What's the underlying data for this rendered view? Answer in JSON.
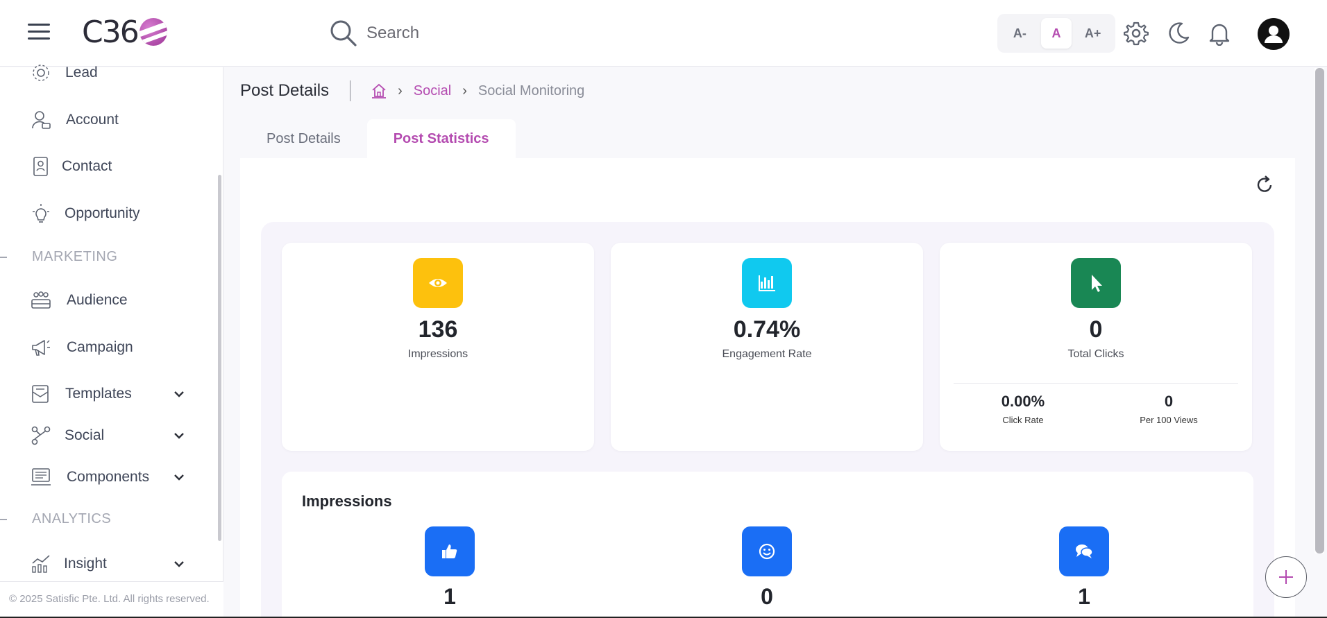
{
  "header": {
    "logo_text": "C36",
    "search_placeholder": "Search",
    "font_small": "A-",
    "font_normal": "A",
    "font_large": "A+"
  },
  "sidebar": {
    "items": [
      {
        "label": "Lead",
        "icon": "lead-icon"
      },
      {
        "label": "Account",
        "icon": "account-icon"
      },
      {
        "label": "Contact",
        "icon": "contact-icon"
      },
      {
        "label": "Opportunity",
        "icon": "lightbulb-icon"
      },
      {
        "label": "Audience",
        "icon": "audience-icon"
      },
      {
        "label": "Campaign",
        "icon": "megaphone-icon"
      },
      {
        "label": "Templates",
        "icon": "templates-icon"
      },
      {
        "label": "Social",
        "icon": "social-icon"
      },
      {
        "label": "Components",
        "icon": "components-icon"
      },
      {
        "label": "Insight",
        "icon": "insight-icon"
      }
    ],
    "sections": {
      "marketing": "MARKETING",
      "analytics": "ANALYTICS"
    },
    "footer": "© 2025 Satisfic Pte. Ltd. All rights reserved."
  },
  "breadcrumb": {
    "page_title": "Post Details",
    "social": "Social",
    "current": "Social Monitoring"
  },
  "tabs": {
    "post_details": "Post Details",
    "post_statistics": "Post Statistics"
  },
  "stats": {
    "impressions": {
      "value": "136",
      "caption": "Impressions"
    },
    "engagement": {
      "value": "0.74%",
      "caption": "Engagement Rate"
    },
    "clicks": {
      "value": "0",
      "caption": "Total Clicks",
      "click_rate_value": "0.00%",
      "click_rate_caption": "Click Rate",
      "per100_value": "0",
      "per100_caption": "Per 100 Views"
    }
  },
  "impressions_section": {
    "title": "Impressions",
    "likes": "1",
    "reactions": "0",
    "comments": "1"
  },
  "colors": {
    "accent": "#b44bb0",
    "yellow": "#fdc10d",
    "cyan": "#10c9ef",
    "green": "#198754",
    "blue": "#1a6ef5"
  }
}
